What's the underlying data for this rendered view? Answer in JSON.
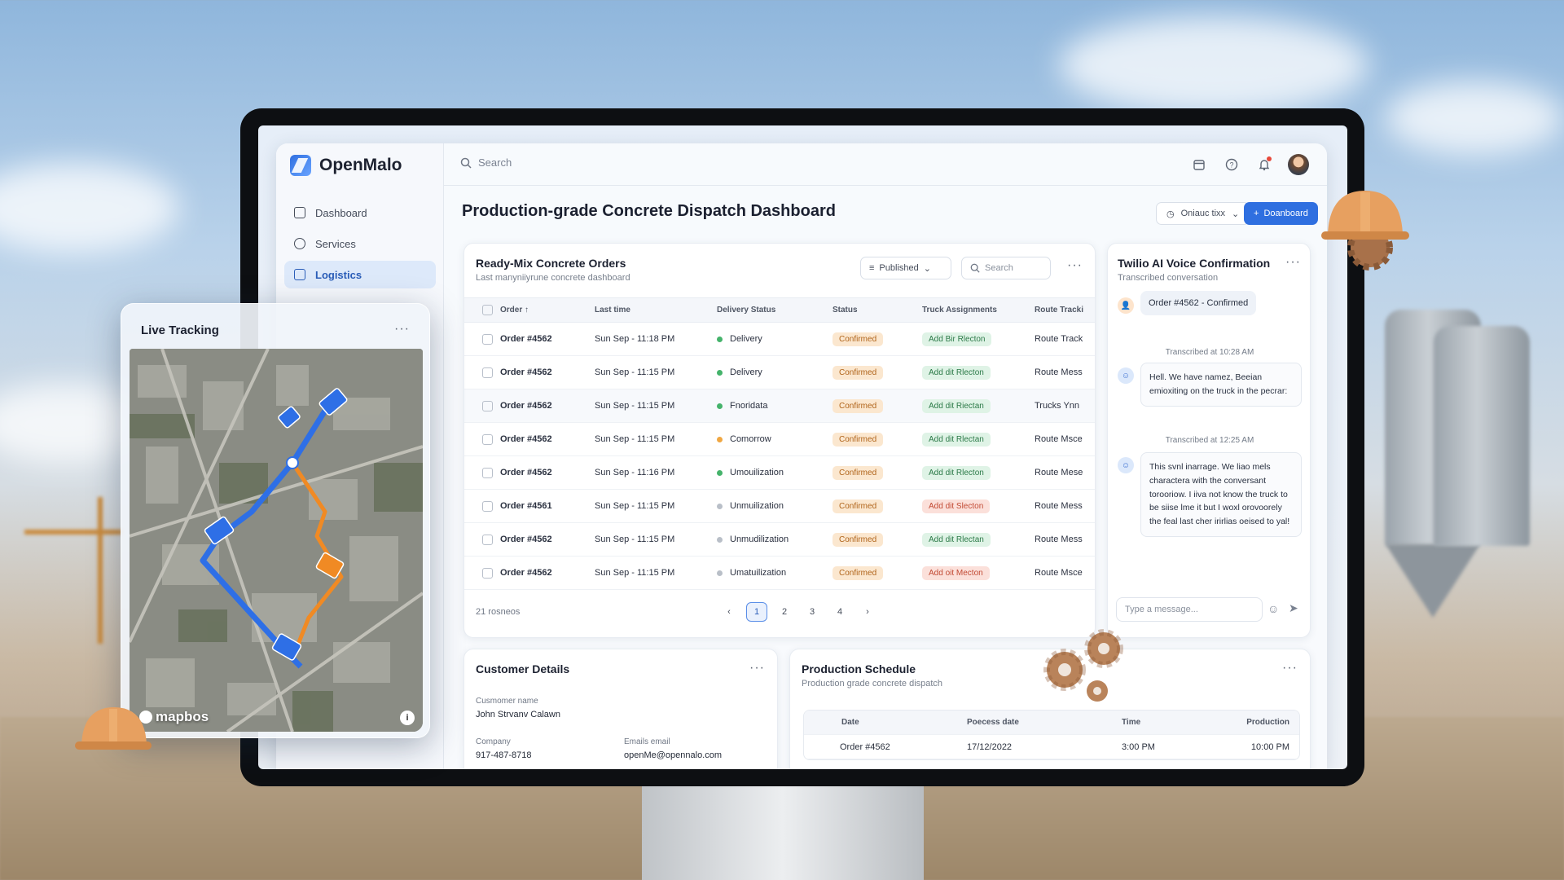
{
  "app": {
    "name": "OpenMalo"
  },
  "sidebar": {
    "items": [
      {
        "label": "Dashboard",
        "active": false
      },
      {
        "label": "Services",
        "active": false
      },
      {
        "label": "Logistics",
        "active": true
      }
    ]
  },
  "topbar": {
    "search_placeholder": "Search"
  },
  "header": {
    "title": "Production-grade Concrete Dispatch Dashboard",
    "org_select": "Oniauc tixx",
    "primary_button": "Doanboard"
  },
  "orders": {
    "title": "Ready-Mix Concrete Orders",
    "subtitle": "Last manyniiyrune concrete dashboard",
    "filter": "Published",
    "search_placeholder": "Search",
    "columns": [
      "Order",
      "Last time",
      "Delivery Status",
      "Status",
      "Truck Assignments",
      "Route Tracki"
    ],
    "rows": [
      {
        "order": "Order #4562",
        "time": "Sun Sep - 11:18 PM",
        "delivery": "Delivery",
        "dot": "#45b36b",
        "status": "Confirmed",
        "truck": "Add Bir Rlecton",
        "truck_style": "green",
        "route": "Route Track"
      },
      {
        "order": "Order #4562",
        "time": "Sun Sep - 11:15 PM",
        "delivery": "Delivery",
        "dot": "#45b36b",
        "status": "Confirmed",
        "truck": "Add dit Rlecton",
        "truck_style": "green",
        "route": "Route Mess"
      },
      {
        "order": "Order #4562",
        "time": "Sun Sep - 11:15 PM",
        "delivery": "Fnoridata",
        "dot": "#45b36b",
        "status": "Confirmed",
        "truck": "Add dit Riectan",
        "truck_style": "green",
        "route": "Trucks Ynn"
      },
      {
        "order": "Order #4562",
        "time": "Sun Sep - 11:15 PM",
        "delivery": "Comorrow",
        "dot": "#f0a742",
        "status": "Confirmed",
        "truck": "Add dit Rlectan",
        "truck_style": "green",
        "route": "Route Msce"
      },
      {
        "order": "Order #4562",
        "time": "Sun Sep - 11:16 PM",
        "delivery": "Umouilization",
        "dot": "#45b36b",
        "status": "Confirmed",
        "truck": "Add dit Rlecton",
        "truck_style": "green",
        "route": "Route Mese"
      },
      {
        "order": "Order #4561",
        "time": "Sun Sep - 11:15 PM",
        "delivery": "Unmuilization",
        "dot": "#b9bfc8",
        "status": "Confirmed",
        "truck": "Add dit Slecton",
        "truck_style": "red",
        "route": "Route Mess"
      },
      {
        "order": "Order #4562",
        "time": "Sun Sep - 11:15 PM",
        "delivery": "Unmudilization",
        "dot": "#b9bfc8",
        "status": "Confirmed",
        "truck": "Add dit Rlectan",
        "truck_style": "green",
        "route": "Route Mess"
      },
      {
        "order": "Order #4562",
        "time": "Sun Sep - 11:15 PM",
        "delivery": "Umatuilization",
        "dot": "#b9bfc8",
        "status": "Confirmed",
        "truck": "Add oit Mecton",
        "truck_style": "red",
        "route": "Route Msce"
      }
    ],
    "footer": "21 rosneos",
    "pages": [
      "1",
      "2",
      "3",
      "4"
    ],
    "current_page": "1"
  },
  "twilio": {
    "title": "Twilio AI Voice Confirmation",
    "subtitle": "Transcribed conversation",
    "chip": "Order #4562 - Confirmed",
    "stamp1": "Transcribed at 10:28 AM",
    "message1": "Hell. We have namez, Beeian emioxiting on the truck in the pecrar:",
    "stamp2": "Transcribed at 12:25 AM",
    "message2": "This svnl inarrage. We liao mels charactera with the conversant torooriow. I iiva not know the truck to be siise lme it but I woxl orovoorely the feal last cher irirlias oeised to yal!",
    "input_placeholder": "Type a message..."
  },
  "customer": {
    "title": "Customer Details",
    "name_label": "Cusmomer name",
    "name": "John Strvanv Calawn",
    "company_label": "Company",
    "company": "917-487-8718",
    "email_label": "Emails email",
    "email": "openMe@opennalo.com"
  },
  "production": {
    "title": "Production Schedule",
    "subtitle": "Production grade concrete dispatch",
    "columns": [
      "Date",
      "Poecess date",
      "Time",
      "Production"
    ],
    "rows": [
      {
        "date": "Order #4562",
        "process": "17/12/2022",
        "time": "3:00 PM",
        "production": "10:00 PM"
      }
    ]
  },
  "tracking": {
    "title": "Live Tracking",
    "attribution": "mapbos"
  },
  "colors": {
    "accent": "#2f6fe0",
    "route_main": "#2e6fe6",
    "route_alt": "#f08a24",
    "confirmed": "#b0641a"
  }
}
